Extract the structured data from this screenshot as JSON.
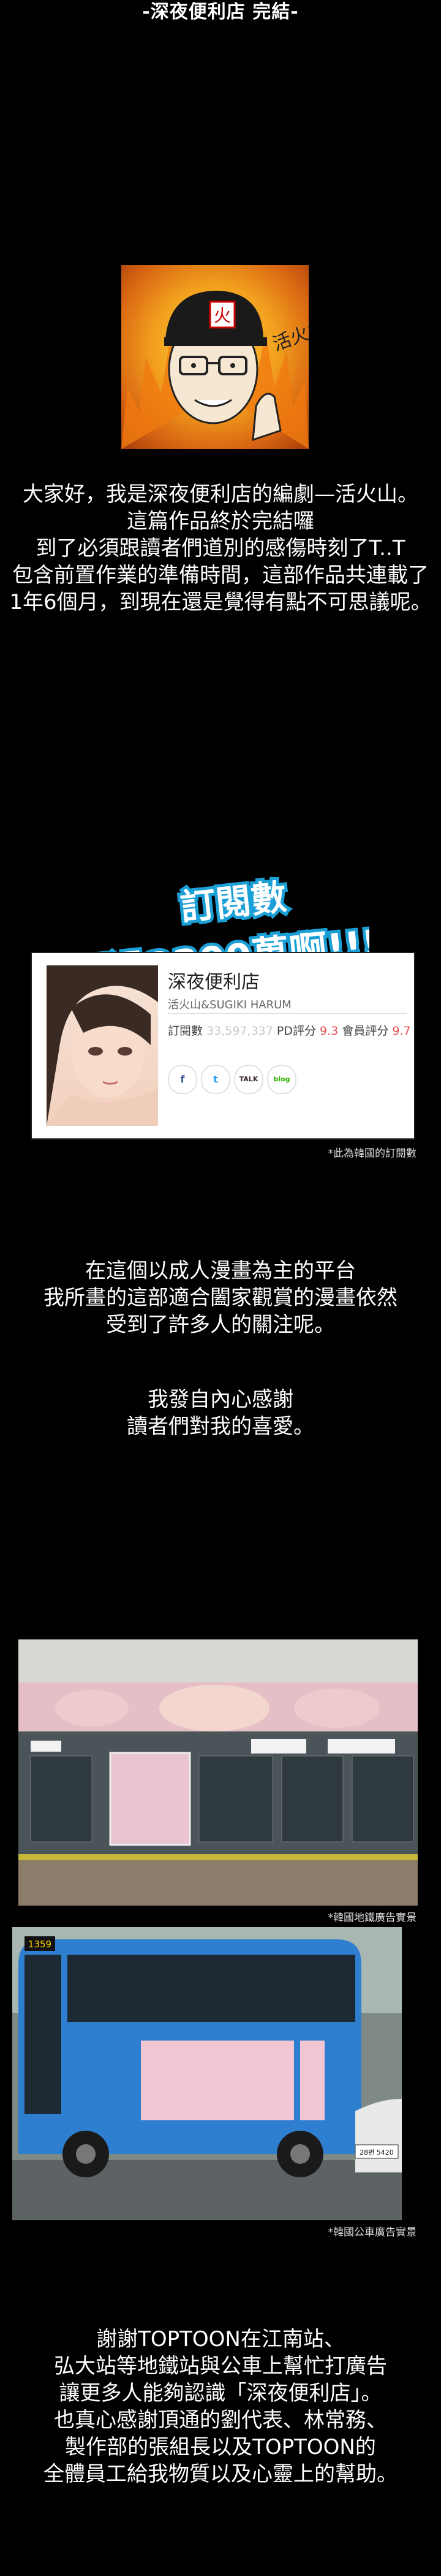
{
  "page": {
    "title": "-深夜便利店 完結-"
  },
  "intro": {
    "lines": [
      "大家好，我是深夜便利店的編劇—活火山。",
      "這篇作品終於完結囉",
      "到了必須跟讀者們道別的感傷時刻了T..T",
      "包含前置作業的準備時間，這部作品共連載了",
      "1年6個月，到現在還是覺得有點不可思議呢。"
    ],
    "portrait_badge": "火",
    "portrait_signature": "活火山"
  },
  "promo": {
    "line1": "訂閱數",
    "line2": "超過3300萬啊!!!"
  },
  "card": {
    "title": "深夜便利店",
    "author": "活火山&SUGIKI HARUM",
    "stats_label_sub": "訂閱數",
    "stats_sub_value": "33,597,337",
    "stats_label_pd": "PD評分",
    "stats_pd_value": "9.3",
    "stats_label_member": "會員評分",
    "stats_member_value": "9.7",
    "icons": [
      "facebook-icon",
      "twitter-icon",
      "talk-icon",
      "blog-icon"
    ],
    "icon_glyphs": [
      "f",
      "t",
      "TALK",
      "blog"
    ],
    "note": "*此為韓國的訂閱數"
  },
  "thanks": {
    "lines": [
      "在這個以成人漫畫為主的平台",
      "我所畫的這部適合闔家觀賞的漫畫依然",
      "受到了許多人的關注呢。"
    ],
    "lines2": [
      "我發自內心感謝",
      "讀者們對我的喜愛。"
    ]
  },
  "photos": {
    "subway_caption": "*韓國地鐵廣告實景",
    "bus_caption": "*韓國公車廣告實景",
    "bus_number": "1359",
    "bus_plate": "28번 5420"
  },
  "closing": {
    "lines": [
      "謝謝TOPTOON在江南站、",
      "弘大站等地鐵站與公車上幫忙打廣告",
      "讓更多人能夠認識「深夜便利店」。",
      "也真心感謝頂通的劉代表、林常務、",
      "製作部的張組長以及TOPTOON的",
      "全體員工給我物質以及心靈上的幫助。"
    ]
  }
}
